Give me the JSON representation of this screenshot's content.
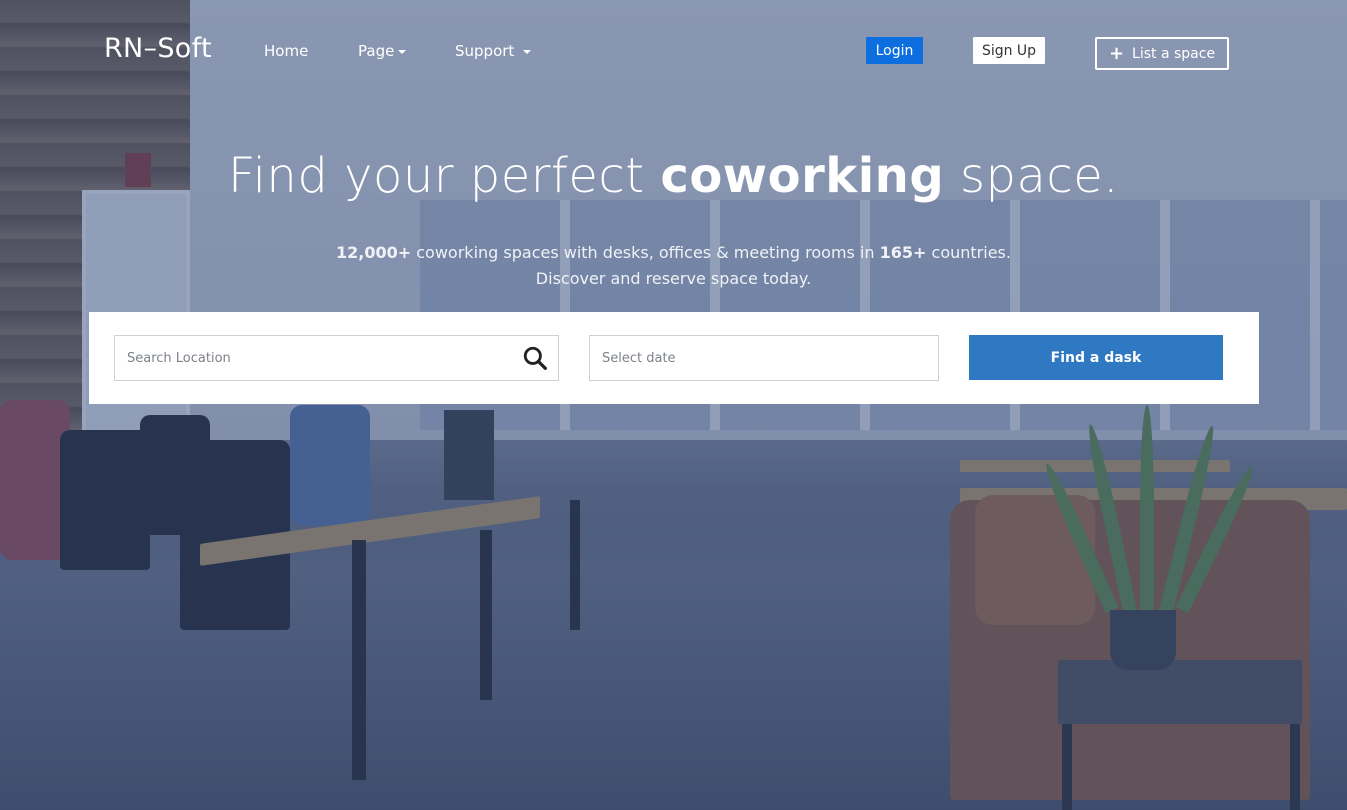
{
  "brand": {
    "name": "RN–Soft"
  },
  "nav": {
    "links": [
      {
        "label": "Home",
        "has_dropdown": false
      },
      {
        "label": "Page",
        "has_dropdown": true
      },
      {
        "label": "Support",
        "has_dropdown": true
      }
    ],
    "login_label": "Login",
    "signup_label": "Sign Up",
    "list_space_label": "List a space",
    "list_space_icon": "plus-icon"
  },
  "hero": {
    "title_part1": "Find your perfect ",
    "title_bold": "coworking",
    "title_part2": " space.",
    "sub_count1": "12,000+",
    "sub_text1": " coworking spaces with desks, offices & meeting rooms in ",
    "sub_count2": "165+",
    "sub_text2": " countries.",
    "sub_line2": "Discover and reserve space today."
  },
  "search": {
    "location_placeholder": "Search Location",
    "date_placeholder": "Select date",
    "button_label": "Find a dask",
    "search_icon": "search-icon"
  },
  "colors": {
    "login_bg": "#0d6ee0",
    "find_button_bg": "#2f79c2",
    "overlay": "#2e487a"
  }
}
